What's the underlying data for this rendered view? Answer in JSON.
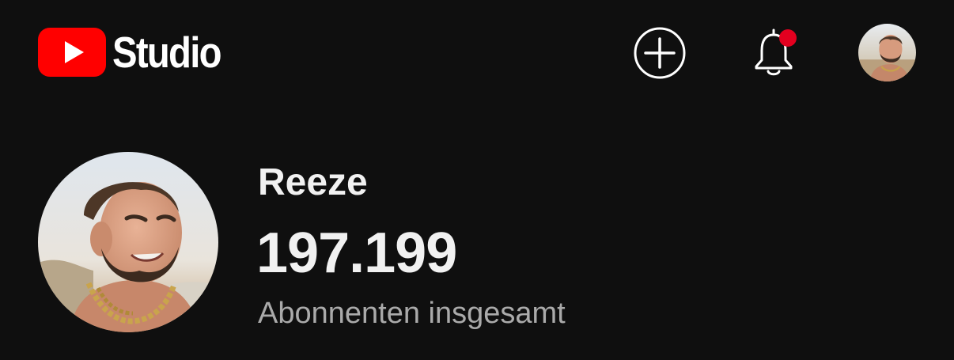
{
  "header": {
    "app_name": "Studio",
    "logo_icon": "youtube-play-icon",
    "create_icon": "plus-circle-icon",
    "notifications_icon": "bell-icon",
    "has_unread_notifications": true,
    "account_icon": "account-avatar"
  },
  "channel": {
    "name": "Reeze",
    "subscriber_count": "197.199",
    "subscriber_label": "Abonnenten insgesamt"
  },
  "colors": {
    "background": "#0f0f0f",
    "brand_red": "#ff0000",
    "notification_dot": "#e3001f",
    "secondary_text": "#aaaaaa"
  }
}
